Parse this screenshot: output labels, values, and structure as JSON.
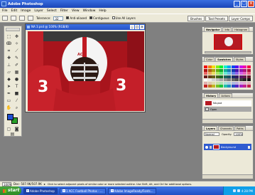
{
  "app": {
    "title": "Adobe Photoshop"
  },
  "menu": [
    "File",
    "Edit",
    "Image",
    "Layer",
    "Select",
    "Filter",
    "View",
    "Window",
    "Help"
  ],
  "options": {
    "tolerance_label": "Tolerance:",
    "tolerance_value": "32",
    "anti_aliased": "Anti-aliased",
    "contiguous": "Contiguous",
    "use_all_layers": "Use All Layers",
    "workspace_tabs": [
      "Brushes",
      "Tool Presets",
      "Layer Comps"
    ]
  },
  "document": {
    "title": "NA 3.psd @ 100% (RGB/8)",
    "jersey_number": "3",
    "helmet_text": "ACC"
  },
  "panels": {
    "navigator": {
      "tabs": [
        "Navigator",
        "Info",
        "Histogram"
      ]
    },
    "color": {
      "tabs": [
        "Color",
        "Swatches",
        "Styles"
      ]
    },
    "history": {
      "tabs": [
        "History",
        "Actions"
      ],
      "items": [
        "NA.psd",
        "Open"
      ]
    },
    "layers": {
      "tabs": [
        "Layers",
        "Channels",
        "Paths"
      ],
      "blend_mode": "Normal",
      "opacity_label": "Opacity:",
      "opacity_value": "100%",
      "layer_name": "Background"
    }
  },
  "status": {
    "zoom": "100%",
    "doc_size": "Doc: 507.9K/507.9K",
    "hint": "Click to select adjacent pixels of similar color or more selected outline. Use Shift, Alt, and Ctrl for additional options."
  },
  "taskbar": {
    "start": "start",
    "tasks": [
      "Adobe Photoshop",
      "1 ACC Football Photos - ...",
      "Adobe ImageReady/Fonts..."
    ],
    "clock": "4:28 PM"
  },
  "colors": {
    "title_bar": "#1a45b8",
    "jersey_red": "#b51a22",
    "foreground": "#2050d0",
    "background_swatch": "#28a028"
  }
}
